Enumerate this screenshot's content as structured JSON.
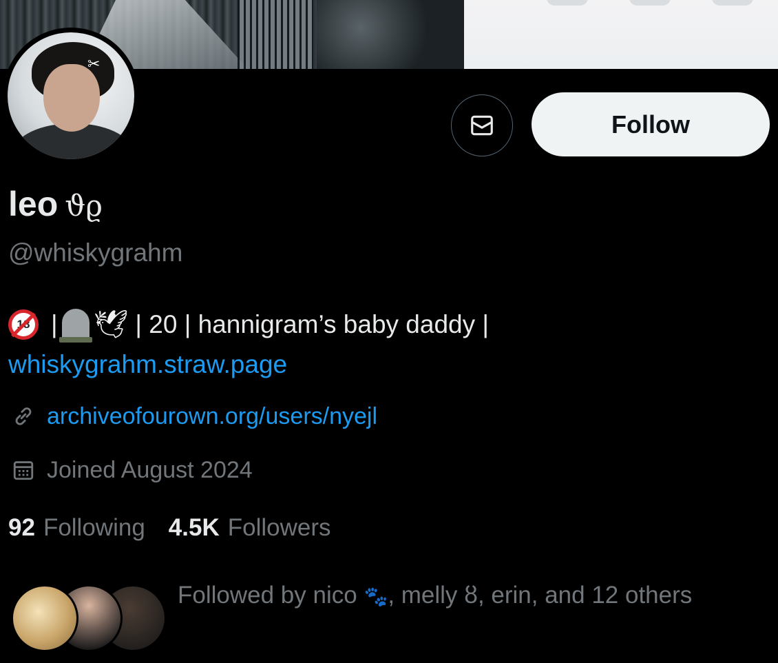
{
  "profile": {
    "name": "leo",
    "name_decoration": "ϑϱ",
    "handle": "@whiskygrahm",
    "follow_label": "Follow"
  },
  "bio": {
    "text_part": "| 20 | hannigram’s baby daddy |",
    "link": "whiskygrahm.straw.page"
  },
  "website": {
    "url": "archiveofourown.org/users/nyejl"
  },
  "joined": "Joined August 2024",
  "stats": {
    "following_count": "92",
    "following_label": "Following",
    "followers_count": "4.5K",
    "followers_label": "Followers"
  },
  "followed_by": {
    "text": "Followed by nico",
    "rest": ", melly ȣ, erin, and 12 others"
  },
  "icons": [
    "mail-icon",
    "link-icon",
    "calendar-icon",
    "18-plus-icon",
    "headstone-icon",
    "dove-icon",
    "paw-prints-icon"
  ],
  "colors": {
    "background": "#000000",
    "link": "#1d9bf0",
    "muted": "#71767b",
    "text": "#e7e9ea",
    "follow_bg": "#eff3f4"
  }
}
